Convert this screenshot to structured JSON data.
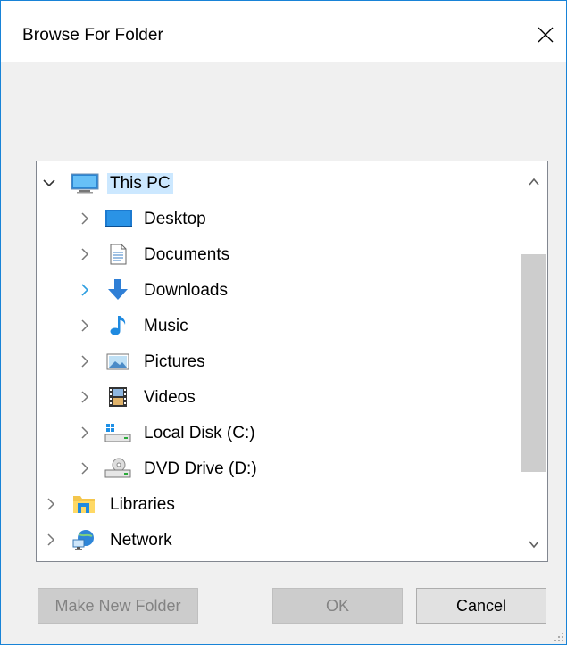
{
  "window": {
    "title": "Browse For Folder"
  },
  "tree": {
    "items": [
      {
        "label": "This PC",
        "icon": "monitor-icon",
        "expanded": true,
        "selected": true,
        "level": 0
      },
      {
        "label": "Desktop",
        "icon": "desktop-icon",
        "level": 1
      },
      {
        "label": "Documents",
        "icon": "documents-icon",
        "level": 1
      },
      {
        "label": "Downloads",
        "icon": "downloads-icon",
        "level": 1,
        "hovered": true
      },
      {
        "label": "Music",
        "icon": "music-icon",
        "level": 1
      },
      {
        "label": "Pictures",
        "icon": "pictures-icon",
        "level": 1
      },
      {
        "label": "Videos",
        "icon": "videos-icon",
        "level": 1
      },
      {
        "label": "Local Disk (C:)",
        "icon": "local-disk-icon",
        "level": 1
      },
      {
        "label": "DVD Drive (D:)",
        "icon": "dvd-drive-icon",
        "level": 1
      },
      {
        "label": "Libraries",
        "icon": "libraries-icon",
        "level": 0
      },
      {
        "label": "Network",
        "icon": "network-icon",
        "level": 0
      }
    ]
  },
  "buttons": {
    "make_new_folder": "Make New Folder",
    "ok": "OK",
    "cancel": "Cancel"
  },
  "colors": {
    "accent": "#1883d7",
    "selection": "#cce8ff",
    "hover_chevron": "#2d9ee0"
  }
}
